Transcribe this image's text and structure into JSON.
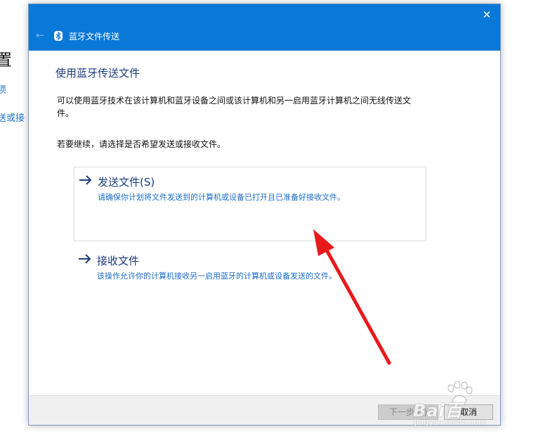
{
  "background_window": {
    "title_fragment": "置",
    "link1_fragment": "项",
    "link2_fragment": "送或接"
  },
  "dialog": {
    "title": "蓝牙文件传送",
    "heading": "使用蓝牙传送文件",
    "description": "可以使用蓝牙技术在该计算机和蓝牙设备之间或该计算机和另一启用蓝牙计算机之间无线传送文件。",
    "prompt": "若要继续，请选择是否希望发送或接收文件。",
    "options": [
      {
        "title": "发送文件(S)",
        "description": "请确保你计划将文件发送到的计算机或设备已打开且已准备好接收文件。"
      },
      {
        "title": "接收文件",
        "description": "该操作允许你的计算机接收另一启用蓝牙的计算机或设备发送的文件。"
      }
    ],
    "footer": {
      "next_label": "下一步(N)",
      "cancel_label": "取消"
    }
  },
  "watermark": {
    "brand": "Bai百",
    "sub": "jingyan.baidu.com"
  },
  "icons": {
    "close": "close-icon",
    "back": "back-arrow-icon",
    "bluetooth": "bluetooth-icon",
    "option_arrow": "right-arrow-icon",
    "annotation": "red-arrow-annotation"
  },
  "colors": {
    "titlebar": "#0a78d7",
    "heading": "#1b3a7a",
    "link": "#1a6cc8",
    "annotation": "#e8191a"
  }
}
